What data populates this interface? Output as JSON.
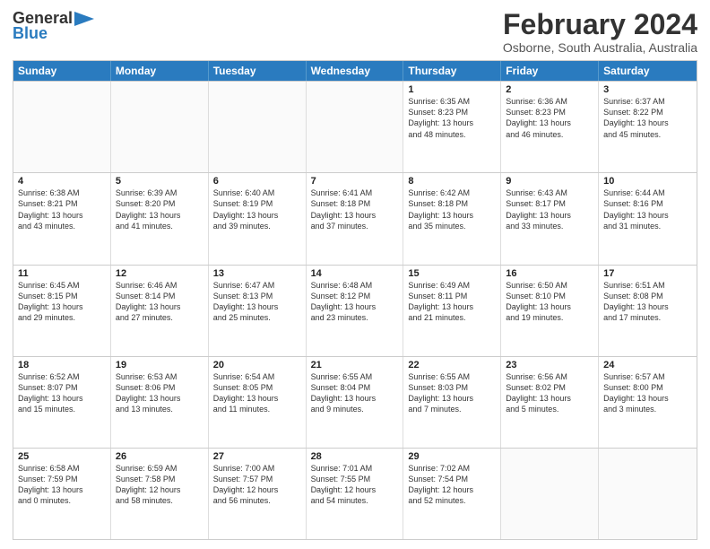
{
  "logo": {
    "line1": "General",
    "line2": "Blue",
    "arrow_color": "#2a7bbf"
  },
  "title": "February 2024",
  "subtitle": "Osborne, South Australia, Australia",
  "header_color": "#2a7bbf",
  "days_of_week": [
    "Sunday",
    "Monday",
    "Tuesday",
    "Wednesday",
    "Thursday",
    "Friday",
    "Saturday"
  ],
  "weeks": [
    [
      {
        "day": "",
        "info": ""
      },
      {
        "day": "",
        "info": ""
      },
      {
        "day": "",
        "info": ""
      },
      {
        "day": "",
        "info": ""
      },
      {
        "day": "1",
        "info": "Sunrise: 6:35 AM\nSunset: 8:23 PM\nDaylight: 13 hours\nand 48 minutes."
      },
      {
        "day": "2",
        "info": "Sunrise: 6:36 AM\nSunset: 8:23 PM\nDaylight: 13 hours\nand 46 minutes."
      },
      {
        "day": "3",
        "info": "Sunrise: 6:37 AM\nSunset: 8:22 PM\nDaylight: 13 hours\nand 45 minutes."
      }
    ],
    [
      {
        "day": "4",
        "info": "Sunrise: 6:38 AM\nSunset: 8:21 PM\nDaylight: 13 hours\nand 43 minutes."
      },
      {
        "day": "5",
        "info": "Sunrise: 6:39 AM\nSunset: 8:20 PM\nDaylight: 13 hours\nand 41 minutes."
      },
      {
        "day": "6",
        "info": "Sunrise: 6:40 AM\nSunset: 8:19 PM\nDaylight: 13 hours\nand 39 minutes."
      },
      {
        "day": "7",
        "info": "Sunrise: 6:41 AM\nSunset: 8:18 PM\nDaylight: 13 hours\nand 37 minutes."
      },
      {
        "day": "8",
        "info": "Sunrise: 6:42 AM\nSunset: 8:18 PM\nDaylight: 13 hours\nand 35 minutes."
      },
      {
        "day": "9",
        "info": "Sunrise: 6:43 AM\nSunset: 8:17 PM\nDaylight: 13 hours\nand 33 minutes."
      },
      {
        "day": "10",
        "info": "Sunrise: 6:44 AM\nSunset: 8:16 PM\nDaylight: 13 hours\nand 31 minutes."
      }
    ],
    [
      {
        "day": "11",
        "info": "Sunrise: 6:45 AM\nSunset: 8:15 PM\nDaylight: 13 hours\nand 29 minutes."
      },
      {
        "day": "12",
        "info": "Sunrise: 6:46 AM\nSunset: 8:14 PM\nDaylight: 13 hours\nand 27 minutes."
      },
      {
        "day": "13",
        "info": "Sunrise: 6:47 AM\nSunset: 8:13 PM\nDaylight: 13 hours\nand 25 minutes."
      },
      {
        "day": "14",
        "info": "Sunrise: 6:48 AM\nSunset: 8:12 PM\nDaylight: 13 hours\nand 23 minutes."
      },
      {
        "day": "15",
        "info": "Sunrise: 6:49 AM\nSunset: 8:11 PM\nDaylight: 13 hours\nand 21 minutes."
      },
      {
        "day": "16",
        "info": "Sunrise: 6:50 AM\nSunset: 8:10 PM\nDaylight: 13 hours\nand 19 minutes."
      },
      {
        "day": "17",
        "info": "Sunrise: 6:51 AM\nSunset: 8:08 PM\nDaylight: 13 hours\nand 17 minutes."
      }
    ],
    [
      {
        "day": "18",
        "info": "Sunrise: 6:52 AM\nSunset: 8:07 PM\nDaylight: 13 hours\nand 15 minutes."
      },
      {
        "day": "19",
        "info": "Sunrise: 6:53 AM\nSunset: 8:06 PM\nDaylight: 13 hours\nand 13 minutes."
      },
      {
        "day": "20",
        "info": "Sunrise: 6:54 AM\nSunset: 8:05 PM\nDaylight: 13 hours\nand 11 minutes."
      },
      {
        "day": "21",
        "info": "Sunrise: 6:55 AM\nSunset: 8:04 PM\nDaylight: 13 hours\nand 9 minutes."
      },
      {
        "day": "22",
        "info": "Sunrise: 6:55 AM\nSunset: 8:03 PM\nDaylight: 13 hours\nand 7 minutes."
      },
      {
        "day": "23",
        "info": "Sunrise: 6:56 AM\nSunset: 8:02 PM\nDaylight: 13 hours\nand 5 minutes."
      },
      {
        "day": "24",
        "info": "Sunrise: 6:57 AM\nSunset: 8:00 PM\nDaylight: 13 hours\nand 3 minutes."
      }
    ],
    [
      {
        "day": "25",
        "info": "Sunrise: 6:58 AM\nSunset: 7:59 PM\nDaylight: 13 hours\nand 0 minutes."
      },
      {
        "day": "26",
        "info": "Sunrise: 6:59 AM\nSunset: 7:58 PM\nDaylight: 12 hours\nand 58 minutes."
      },
      {
        "day": "27",
        "info": "Sunrise: 7:00 AM\nSunset: 7:57 PM\nDaylight: 12 hours\nand 56 minutes."
      },
      {
        "day": "28",
        "info": "Sunrise: 7:01 AM\nSunset: 7:55 PM\nDaylight: 12 hours\nand 54 minutes."
      },
      {
        "day": "29",
        "info": "Sunrise: 7:02 AM\nSunset: 7:54 PM\nDaylight: 12 hours\nand 52 minutes."
      },
      {
        "day": "",
        "info": ""
      },
      {
        "day": "",
        "info": ""
      }
    ]
  ]
}
